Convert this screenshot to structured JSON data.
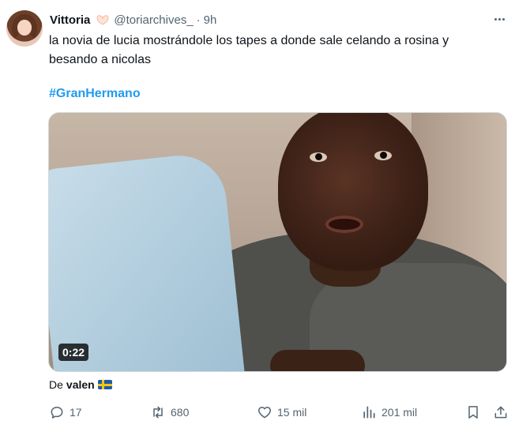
{
  "author": {
    "display_name": "Vittoria",
    "name_emoji": "heart-hands-emoji",
    "handle": "@toriarchives_",
    "separator": "·",
    "time": "9h"
  },
  "tweet": {
    "text": "la novia de lucia mostrándole los tapes a donde sale celando a rosina y besando a nicolas",
    "hashtag": "#GranHermano"
  },
  "media": {
    "duration": "0:22"
  },
  "attribution": {
    "prefix": "De",
    "name": "valen",
    "flag": "sweden-flag"
  },
  "actions": {
    "replies": "17",
    "retweets": "680",
    "likes": "15 mil",
    "views": "201 mil"
  },
  "colors": {
    "text": "#0f1419",
    "secondary": "#536471",
    "link": "#1d9bf0"
  }
}
